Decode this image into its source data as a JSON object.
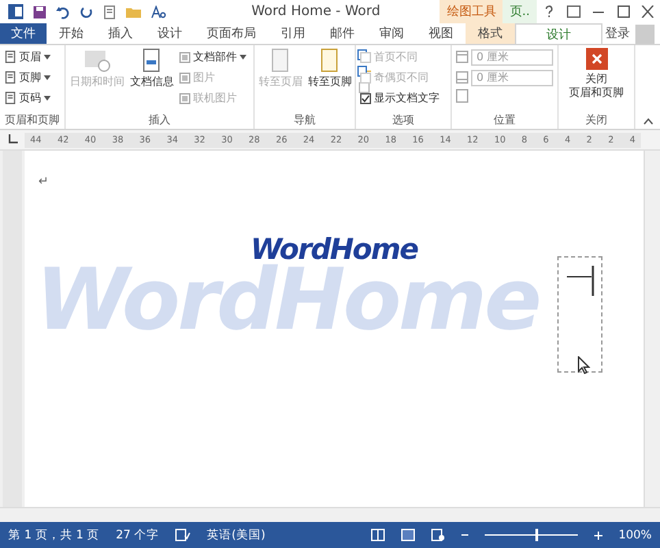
{
  "window": {
    "title": "Word Home - Word",
    "context_tab": "绘图工具",
    "context_tab_2": "页.."
  },
  "tabs": [
    {
      "label": "文件",
      "kind": "file",
      "selected": false
    },
    {
      "label": "开始",
      "kind": "tab",
      "selected": false
    },
    {
      "label": "插入",
      "kind": "tab",
      "selected": false
    },
    {
      "label": "设计",
      "kind": "tab",
      "selected": false
    },
    {
      "label": "页面布局",
      "kind": "tab",
      "selected": false
    },
    {
      "label": "引用",
      "kind": "tab",
      "selected": false
    },
    {
      "label": "邮件",
      "kind": "tab",
      "selected": false
    },
    {
      "label": "审阅",
      "kind": "tab",
      "selected": false
    },
    {
      "label": "视图",
      "kind": "tab",
      "selected": false
    },
    {
      "label": "格式",
      "kind": "context",
      "selected": false
    },
    {
      "label": "设计",
      "kind": "context2",
      "selected": true
    }
  ],
  "signin": "登录",
  "ribbon": {
    "header_footer": {
      "items": [
        "页眉",
        "页脚",
        "页码"
      ],
      "label": "页眉和页脚"
    },
    "insert": {
      "date": "日期和时间",
      "docinfo": "文档信息",
      "parts": "文档部件",
      "picture": "图片",
      "online": "联机图片",
      "label": "插入"
    },
    "nav": {
      "prev": "转至页眉",
      "next": "转至页脚",
      "label": "导航"
    },
    "options": {
      "items": [
        {
          "label": "首页不同",
          "checked": false
        },
        {
          "label": "奇偶页不同",
          "checked": false
        },
        {
          "label": "显示文档文字",
          "checked": true
        }
      ],
      "label": "选项"
    },
    "position": {
      "fields": [
        "0 厘米",
        "0 厘米"
      ],
      "label": "位置"
    },
    "close": {
      "button_lines": [
        "关闭",
        "页眉和页脚"
      ],
      "label": "关闭"
    }
  },
  "ruler": [
    "44",
    "42",
    "40",
    "38",
    "36",
    "34",
    "32",
    "30",
    "28",
    "26",
    "24",
    "22",
    "20",
    "18",
    "16",
    "14",
    "12",
    "10",
    "8",
    "6",
    "4",
    "2",
    "2",
    "4"
  ],
  "document": {
    "paragraph_mark": "↵",
    "heading": "WordHome",
    "watermark": "WordHome"
  },
  "status_bar": {
    "page": "第 1 页，共 1 页",
    "words": "27 个字",
    "language": "英语(美国)",
    "zoom_slider": {
      "level": 0.55
    },
    "zoom": "100%"
  }
}
